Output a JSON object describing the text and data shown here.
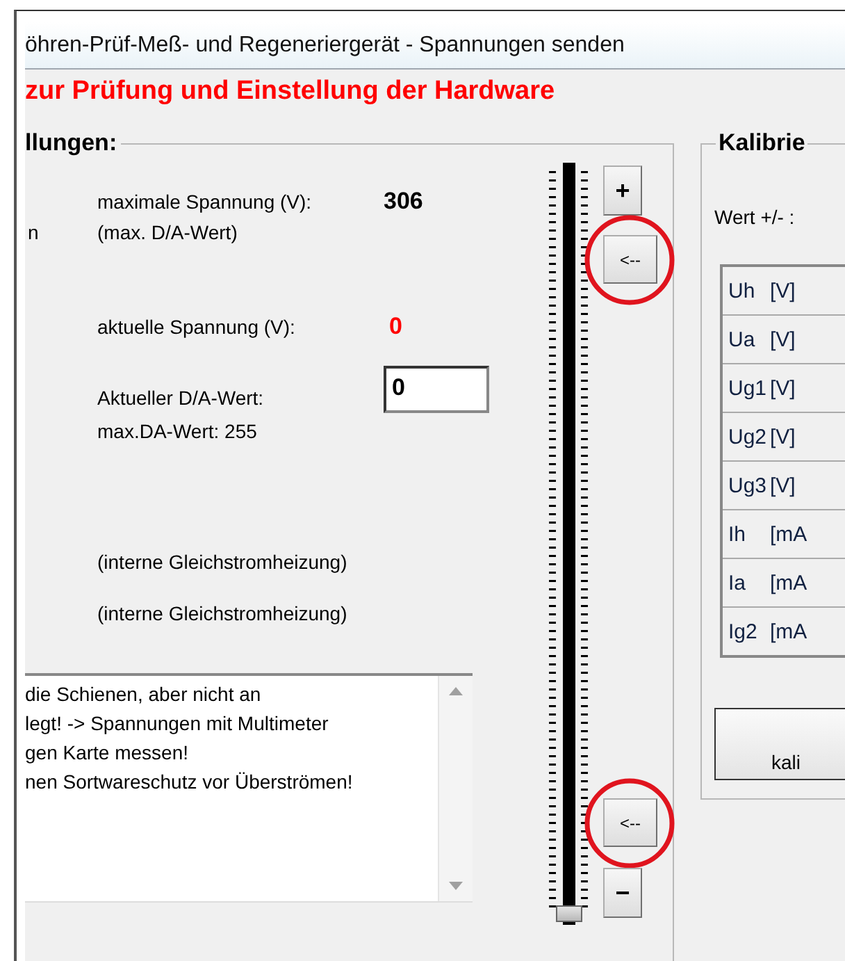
{
  "window": {
    "title": "öhren-Prüf-Meß- und Regeneriergerät - Spannungen senden"
  },
  "heading": "zur Prüfung und Einstellung der Hardware",
  "settings": {
    "title": "llungen:",
    "cut_label": "n",
    "max_voltage_label": "maximale Spannung (V):",
    "max_voltage_value": "306",
    "max_da_note": "(max. D/A-Wert)",
    "current_voltage_label": "aktuelle Spannung (V):",
    "current_voltage_value": "0",
    "current_da_label": "Aktueller D/A-Wert:",
    "current_da_value": "0",
    "max_da_label": "max.DA-Wert: 255",
    "heating_notes": [
      "(interne Gleichstromheizung)",
      "(interne Gleichstromheizung)"
    ],
    "notes": [
      "die Schienen, aber nicht an",
      "legt! -> Spannungen mit Multimeter",
      "gen Karte messen!",
      "nen Sortwareschutz vor Überströmen!"
    ],
    "slider": {
      "level": 0
    },
    "top_buttons": [
      {
        "label": "+",
        "highlighted": false
      },
      {
        "label": "<--",
        "highlighted": true
      }
    ],
    "bottom_buttons": [
      {
        "label": "<--",
        "highlighted": true
      },
      {
        "label": "−",
        "highlighted": false
      }
    ]
  },
  "calibration": {
    "title": "Kalibrie",
    "step_label": "Wert +/- :",
    "rows": [
      {
        "name": "Uh",
        "unit": "[V]"
      },
      {
        "name": "Ua",
        "unit": "[V]"
      },
      {
        "name": "Ug1",
        "unit": "[V]"
      },
      {
        "name": "Ug2",
        "unit": "[V]"
      },
      {
        "name": "Ug3",
        "unit": "[V]"
      },
      {
        "name": "Ih",
        "unit": "[mA"
      },
      {
        "name": "Ia",
        "unit": "[mA"
      },
      {
        "name": "Ig2",
        "unit": "[mA"
      }
    ],
    "button": "kali"
  }
}
